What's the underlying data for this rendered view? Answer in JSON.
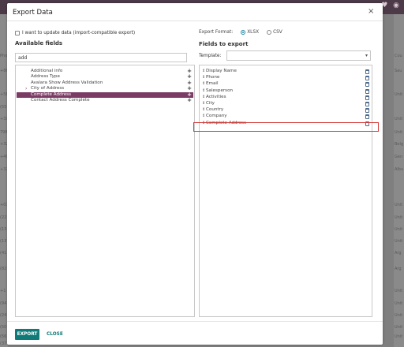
{
  "background": {
    "left_fragments": [
      "Pho",
      "+86",
      "+58",
      "(55)",
      "+31",
      "7989",
      "+32",
      "+49",
      "+32",
      "+07",
      "(22",
      "(13",
      "(137",
      "(41",
      "(82",
      "+1 3",
      "(94",
      "(24",
      "(50",
      "(56",
      "(37"
    ],
    "right_fragments": [
      "Cou",
      "Sau",
      "Unit",
      "Unit",
      "Unit",
      "Belg",
      "Gen",
      "Albu",
      "Unit",
      "Unit",
      "Unit",
      "Unit",
      "Arg",
      "Arg",
      "Unit",
      "Unit",
      "Unit",
      "Unit",
      "Unit"
    ],
    "top_icons": "♥ ◉"
  },
  "dialog": {
    "title": "Export Data",
    "close_glyph": "×",
    "update_checkbox_label": "I want to update data (import-compatible export)",
    "available_title": "Available fields",
    "search_value": "add",
    "available_fields": [
      {
        "label": "Additional info",
        "expandable": false,
        "selected": false
      },
      {
        "label": "Address Type",
        "expandable": false,
        "selected": false
      },
      {
        "label": "Avalara Show Address Validation",
        "expandable": false,
        "selected": false
      },
      {
        "label": "City of Address",
        "expandable": true,
        "selected": false
      },
      {
        "label": "Complete Address",
        "expandable": false,
        "selected": true
      },
      {
        "label": "Contact Address Complete",
        "expandable": false,
        "selected": false
      }
    ],
    "add_glyph": "+",
    "expand_glyph": "›",
    "export_format_label": "Export Format:",
    "formats": [
      {
        "label": "XLSX",
        "selected": true
      },
      {
        "label": "CSV",
        "selected": false
      }
    ],
    "fields_to_export_title": "Fields to export",
    "template_label": "Template:",
    "template_value": "",
    "export_fields": [
      "Display Name",
      "Phone",
      "Email",
      "Salesperson",
      "Activities",
      "City",
      "Country",
      "Company",
      "Complete Address"
    ],
    "highlighted_field": "Complete Address",
    "export_button": "EXPORT",
    "close_button": "CLOSE"
  },
  "colors": {
    "accent": "#7a3b64",
    "primary_button": "#0f7a78",
    "highlight": "#d43a3a"
  }
}
